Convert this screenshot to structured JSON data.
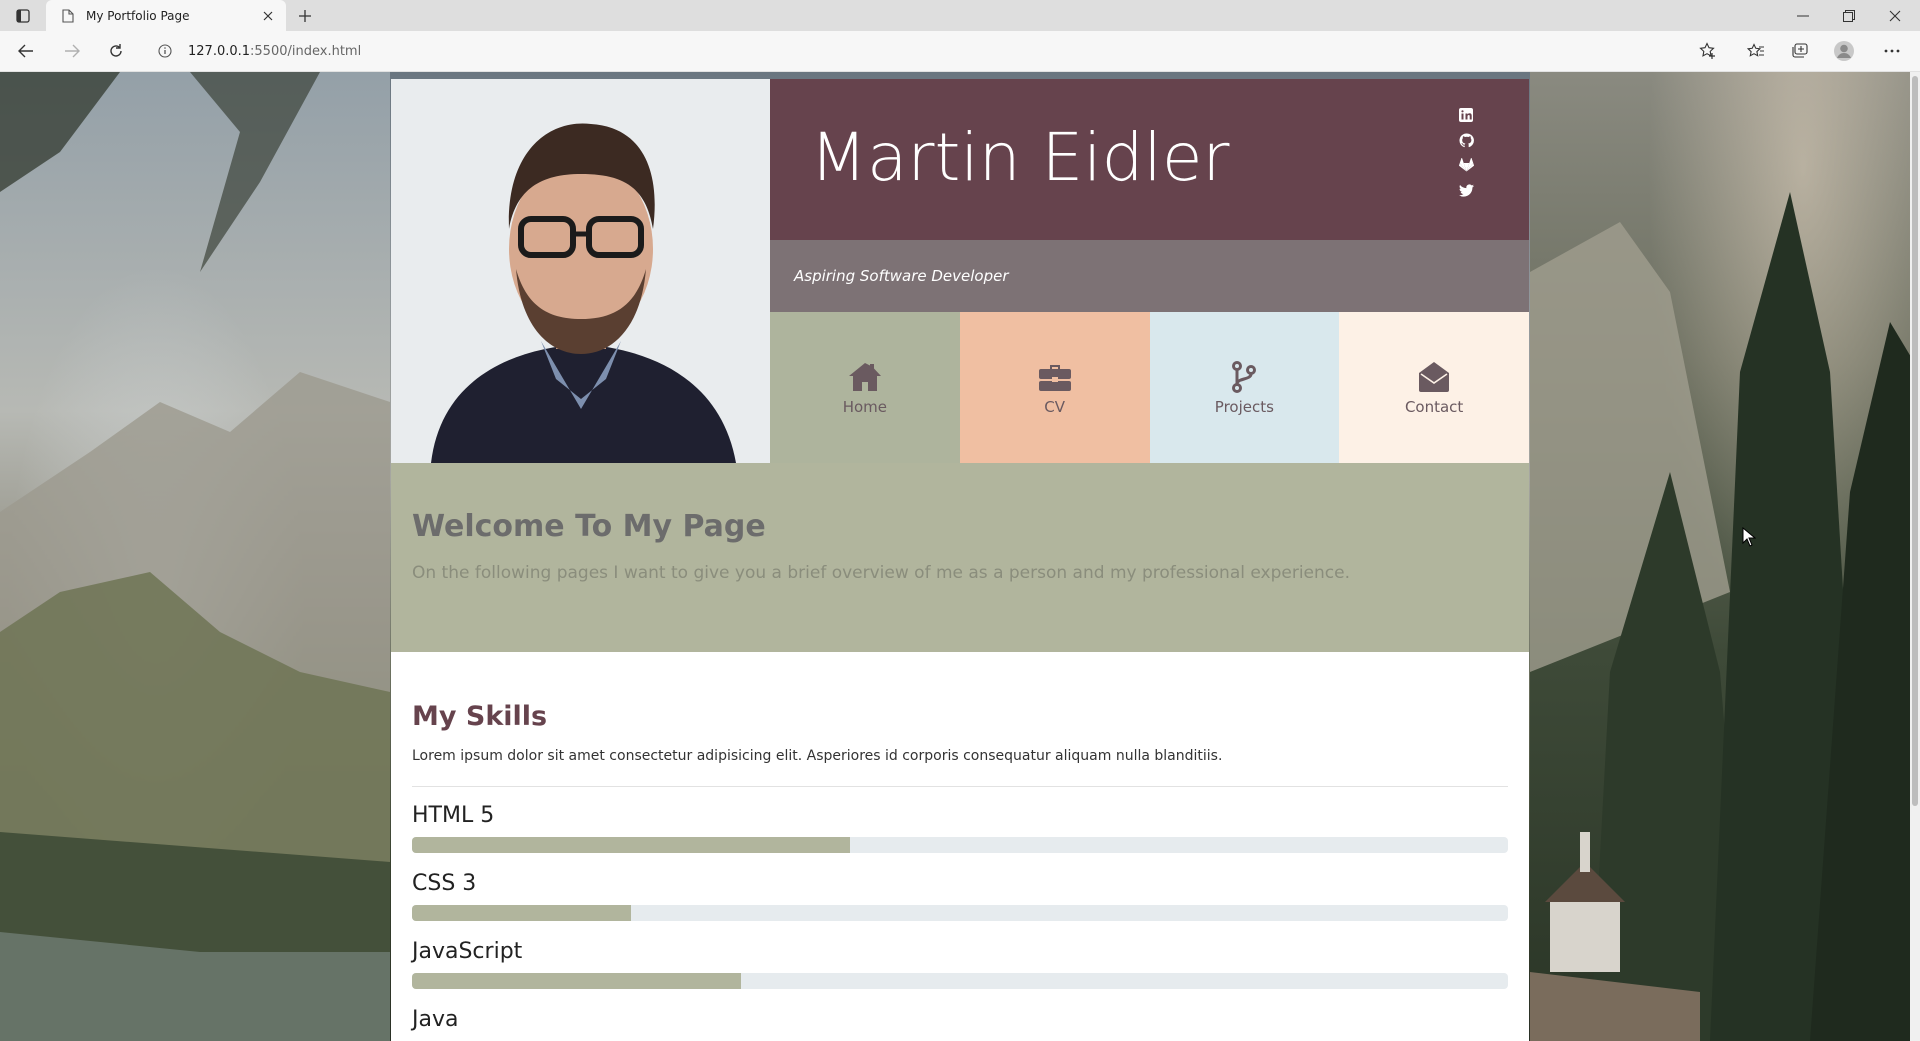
{
  "browser": {
    "tab_title": "My Portfolio Page",
    "url_host": "127.0.0.1",
    "url_rest": ":5500/index.html"
  },
  "profile": {
    "name": "Martin Eidler",
    "subtitle": "Aspiring Software Developer",
    "social_icons": [
      "linkedin-icon",
      "github-icon",
      "gitlab-icon",
      "twitter-icon"
    ]
  },
  "nav": {
    "items": [
      {
        "label": "Home",
        "icon": "home-icon",
        "bg": "#aeb49d"
      },
      {
        "label": "CV",
        "icon": "briefcase-icon",
        "bg": "#f0bfa2"
      },
      {
        "label": "Projects",
        "icon": "code-branch-icon",
        "bg": "#d9e8ed"
      },
      {
        "label": "Contact",
        "icon": "envelope-open-icon",
        "bg": "#fdf1e6"
      }
    ]
  },
  "welcome": {
    "title": "Welcome To My Page",
    "text": "On the following pages I want to give you a brief overview of me as a person and my professional experience."
  },
  "skills": {
    "title": "My Skills",
    "text": "Lorem ipsum dolor sit amet consectetur adipisicing elit. Asperiores id corporis consequatur aliquam nulla blanditiis.",
    "items": [
      {
        "name": "HTML 5",
        "level": 0.4
      },
      {
        "name": "CSS 3",
        "level": 0.2
      },
      {
        "name": "JavaScript",
        "level": 0.3
      },
      {
        "name": "Java",
        "level": 0.0
      }
    ]
  },
  "colors": {
    "header": "#66434d",
    "subheader": "#7d7275",
    "accent": "#b1b59d"
  }
}
